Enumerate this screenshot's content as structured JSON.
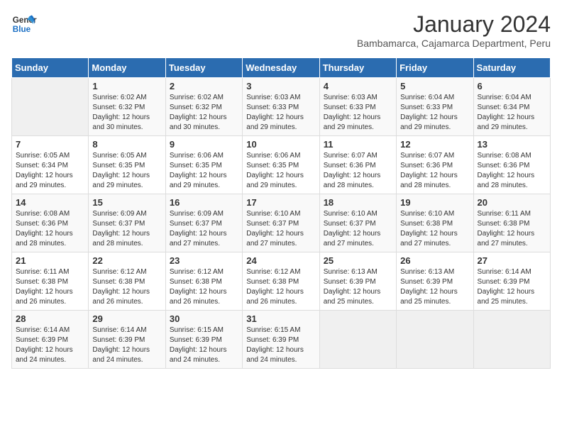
{
  "logo": {
    "line1": "General",
    "line2": "Blue"
  },
  "title": "January 2024",
  "subtitle": "Bambamarca, Cajamarca Department, Peru",
  "header": {
    "days": [
      "Sunday",
      "Monday",
      "Tuesday",
      "Wednesday",
      "Thursday",
      "Friday",
      "Saturday"
    ]
  },
  "weeks": [
    [
      {
        "day": "",
        "sunrise": "",
        "sunset": "",
        "daylight": ""
      },
      {
        "day": "1",
        "sunrise": "Sunrise: 6:02 AM",
        "sunset": "Sunset: 6:32 PM",
        "daylight": "Daylight: 12 hours and 30 minutes."
      },
      {
        "day": "2",
        "sunrise": "Sunrise: 6:02 AM",
        "sunset": "Sunset: 6:32 PM",
        "daylight": "Daylight: 12 hours and 30 minutes."
      },
      {
        "day": "3",
        "sunrise": "Sunrise: 6:03 AM",
        "sunset": "Sunset: 6:33 PM",
        "daylight": "Daylight: 12 hours and 29 minutes."
      },
      {
        "day": "4",
        "sunrise": "Sunrise: 6:03 AM",
        "sunset": "Sunset: 6:33 PM",
        "daylight": "Daylight: 12 hours and 29 minutes."
      },
      {
        "day": "5",
        "sunrise": "Sunrise: 6:04 AM",
        "sunset": "Sunset: 6:33 PM",
        "daylight": "Daylight: 12 hours and 29 minutes."
      },
      {
        "day": "6",
        "sunrise": "Sunrise: 6:04 AM",
        "sunset": "Sunset: 6:34 PM",
        "daylight": "Daylight: 12 hours and 29 minutes."
      }
    ],
    [
      {
        "day": "7",
        "sunrise": "Sunrise: 6:05 AM",
        "sunset": "Sunset: 6:34 PM",
        "daylight": "Daylight: 12 hours and 29 minutes."
      },
      {
        "day": "8",
        "sunrise": "Sunrise: 6:05 AM",
        "sunset": "Sunset: 6:35 PM",
        "daylight": "Daylight: 12 hours and 29 minutes."
      },
      {
        "day": "9",
        "sunrise": "Sunrise: 6:06 AM",
        "sunset": "Sunset: 6:35 PM",
        "daylight": "Daylight: 12 hours and 29 minutes."
      },
      {
        "day": "10",
        "sunrise": "Sunrise: 6:06 AM",
        "sunset": "Sunset: 6:35 PM",
        "daylight": "Daylight: 12 hours and 29 minutes."
      },
      {
        "day": "11",
        "sunrise": "Sunrise: 6:07 AM",
        "sunset": "Sunset: 6:36 PM",
        "daylight": "Daylight: 12 hours and 28 minutes."
      },
      {
        "day": "12",
        "sunrise": "Sunrise: 6:07 AM",
        "sunset": "Sunset: 6:36 PM",
        "daylight": "Daylight: 12 hours and 28 minutes."
      },
      {
        "day": "13",
        "sunrise": "Sunrise: 6:08 AM",
        "sunset": "Sunset: 6:36 PM",
        "daylight": "Daylight: 12 hours and 28 minutes."
      }
    ],
    [
      {
        "day": "14",
        "sunrise": "Sunrise: 6:08 AM",
        "sunset": "Sunset: 6:36 PM",
        "daylight": "Daylight: 12 hours and 28 minutes."
      },
      {
        "day": "15",
        "sunrise": "Sunrise: 6:09 AM",
        "sunset": "Sunset: 6:37 PM",
        "daylight": "Daylight: 12 hours and 28 minutes."
      },
      {
        "day": "16",
        "sunrise": "Sunrise: 6:09 AM",
        "sunset": "Sunset: 6:37 PM",
        "daylight": "Daylight: 12 hours and 27 minutes."
      },
      {
        "day": "17",
        "sunrise": "Sunrise: 6:10 AM",
        "sunset": "Sunset: 6:37 PM",
        "daylight": "Daylight: 12 hours and 27 minutes."
      },
      {
        "day": "18",
        "sunrise": "Sunrise: 6:10 AM",
        "sunset": "Sunset: 6:37 PM",
        "daylight": "Daylight: 12 hours and 27 minutes."
      },
      {
        "day": "19",
        "sunrise": "Sunrise: 6:10 AM",
        "sunset": "Sunset: 6:38 PM",
        "daylight": "Daylight: 12 hours and 27 minutes."
      },
      {
        "day": "20",
        "sunrise": "Sunrise: 6:11 AM",
        "sunset": "Sunset: 6:38 PM",
        "daylight": "Daylight: 12 hours and 27 minutes."
      }
    ],
    [
      {
        "day": "21",
        "sunrise": "Sunrise: 6:11 AM",
        "sunset": "Sunset: 6:38 PM",
        "daylight": "Daylight: 12 hours and 26 minutes."
      },
      {
        "day": "22",
        "sunrise": "Sunrise: 6:12 AM",
        "sunset": "Sunset: 6:38 PM",
        "daylight": "Daylight: 12 hours and 26 minutes."
      },
      {
        "day": "23",
        "sunrise": "Sunrise: 6:12 AM",
        "sunset": "Sunset: 6:38 PM",
        "daylight": "Daylight: 12 hours and 26 minutes."
      },
      {
        "day": "24",
        "sunrise": "Sunrise: 6:12 AM",
        "sunset": "Sunset: 6:38 PM",
        "daylight": "Daylight: 12 hours and 26 minutes."
      },
      {
        "day": "25",
        "sunrise": "Sunrise: 6:13 AM",
        "sunset": "Sunset: 6:39 PM",
        "daylight": "Daylight: 12 hours and 25 minutes."
      },
      {
        "day": "26",
        "sunrise": "Sunrise: 6:13 AM",
        "sunset": "Sunset: 6:39 PM",
        "daylight": "Daylight: 12 hours and 25 minutes."
      },
      {
        "day": "27",
        "sunrise": "Sunrise: 6:14 AM",
        "sunset": "Sunset: 6:39 PM",
        "daylight": "Daylight: 12 hours and 25 minutes."
      }
    ],
    [
      {
        "day": "28",
        "sunrise": "Sunrise: 6:14 AM",
        "sunset": "Sunset: 6:39 PM",
        "daylight": "Daylight: 12 hours and 24 minutes."
      },
      {
        "day": "29",
        "sunrise": "Sunrise: 6:14 AM",
        "sunset": "Sunset: 6:39 PM",
        "daylight": "Daylight: 12 hours and 24 minutes."
      },
      {
        "day": "30",
        "sunrise": "Sunrise: 6:15 AM",
        "sunset": "Sunset: 6:39 PM",
        "daylight": "Daylight: 12 hours and 24 minutes."
      },
      {
        "day": "31",
        "sunrise": "Sunrise: 6:15 AM",
        "sunset": "Sunset: 6:39 PM",
        "daylight": "Daylight: 12 hours and 24 minutes."
      },
      {
        "day": "",
        "sunrise": "",
        "sunset": "",
        "daylight": ""
      },
      {
        "day": "",
        "sunrise": "",
        "sunset": "",
        "daylight": ""
      },
      {
        "day": "",
        "sunrise": "",
        "sunset": "",
        "daylight": ""
      }
    ]
  ]
}
